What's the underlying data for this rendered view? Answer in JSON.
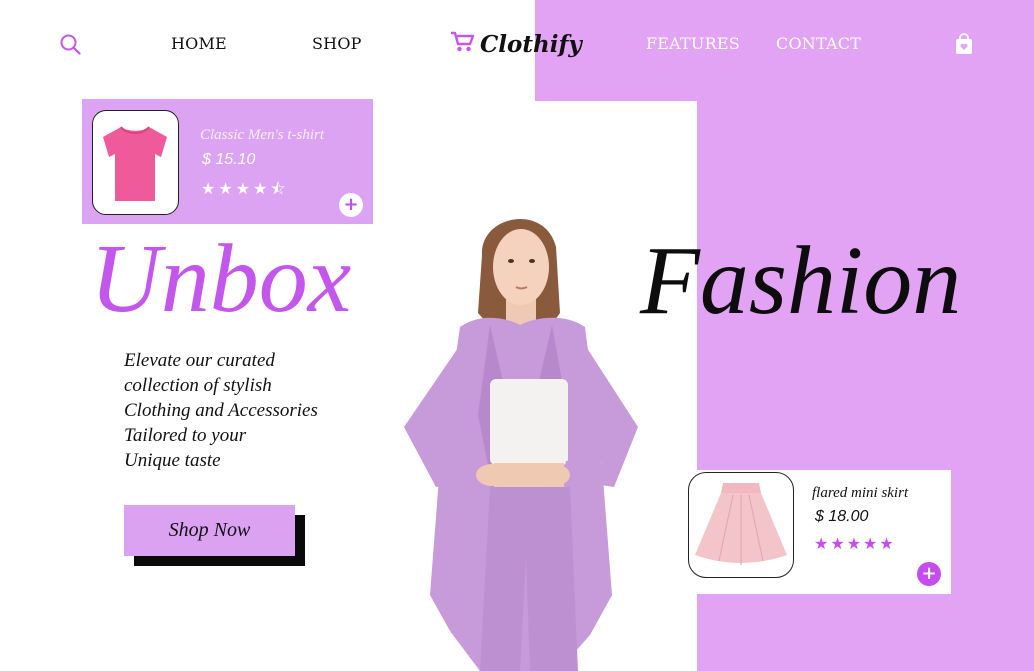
{
  "header": {
    "nav": [
      "HOME",
      "SHOP",
      "FEATURES",
      "CONTACT"
    ],
    "logo": "Clothify",
    "icons": [
      "search-icon",
      "cart-logo-icon",
      "shopping-bag-icon"
    ]
  },
  "product_cards": [
    {
      "name": "Classic Men's t-shirt",
      "price": "$ 15.10",
      "stars": "★★★★⯪",
      "rating": 4.5,
      "add_label": "+"
    },
    {
      "name": "flared mini skirt",
      "price": "$ 18.00",
      "stars": "★★★★★",
      "rating": 5,
      "add_label": "+"
    }
  ],
  "hero": {
    "word_left": "Unbox",
    "word_right": "Fashion",
    "description": [
      "Elevate our curated",
      "collection of stylish",
      "Clothing and Accessories",
      "Tailored to your",
      "Unique taste"
    ],
    "cta": "Shop Now"
  },
  "colors": {
    "accent": "#e3a3f5",
    "brand_purple": "#c356eb",
    "tshirt_pink": "#ee5a9a",
    "skirt_pink": "#f3c4c9",
    "suit_lilac": "#c79ad9"
  }
}
